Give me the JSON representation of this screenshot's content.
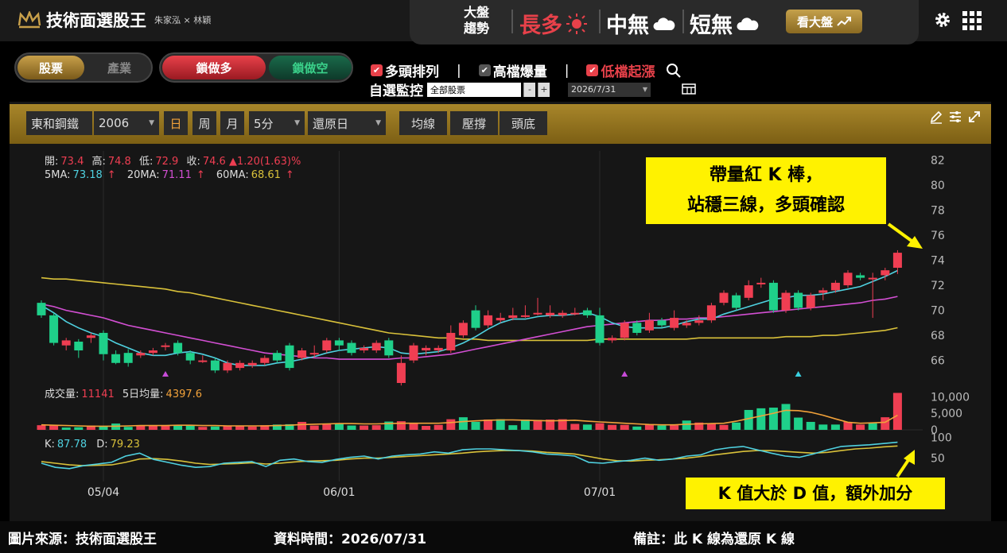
{
  "app": {
    "name": "技術面選股王",
    "authors": "朱家泓 × 林穎"
  },
  "market_trend": {
    "label_line1": "大盤",
    "label_line2": "趨勢",
    "long": "長多",
    "mid": "中無",
    "short": "短無",
    "market_button": "看大盤"
  },
  "toolbar": {
    "tab_stock": "股票",
    "tab_industry": "產業",
    "lock_long": "鎖做多",
    "lock_short": "鎖做空",
    "filter_bull": "多頭排列",
    "filter_volume": "高檔爆量",
    "filter_low": "低檔起漲",
    "separator": "|",
    "watch_label": "自選監控",
    "watch_select": "全部股票",
    "watch_minus": "-",
    "watch_plus": "+",
    "date_select": "2026/7/31"
  },
  "chart_toolbar": {
    "stock_name": "東和鋼鐵",
    "stock_code": "2006",
    "period_day": "日",
    "period_week": "周",
    "period_month": "月",
    "interval": "5分",
    "adjust": "還原日",
    "btn_ma": "均線",
    "btn_pressure": "壓撐",
    "btn_bottom": "頭底"
  },
  "quote": {
    "open_label": "開:",
    "open": "73.4",
    "high_label": "高:",
    "high": "74.8",
    "low_label": "低:",
    "low": "72.9",
    "close_label": "收:",
    "close": "74.6",
    "change": "▲1.20(1.63)%",
    "ma5_label": "5MA:",
    "ma5": "73.18",
    "ma20_label": "20MA:",
    "ma20": "71.11",
    "ma60_label": "60MA:",
    "ma60": "68.61",
    "up_arrow": "↑",
    "vol_label": "成交量:",
    "vol": "11141",
    "vol5_label": "5日均量:",
    "vol5": "4397.6",
    "k_label": "K:",
    "k": "87.78",
    "d_label": "D:",
    "d": "79.23"
  },
  "footer": {
    "source": "圖片來源：技術面選股王",
    "data_time": "資料時間：2026/07/31",
    "note": "備註：此 K 線為還原 K 線"
  },
  "callouts": {
    "c1_line1": "帶量紅 K 棒，",
    "c1_line2": "站穩三線，多頭確認",
    "c2": "K 值大於 D 值，額外加分"
  },
  "colors": {
    "up": "#ef3e52",
    "down": "#1fd08a",
    "ma5": "#4fd1e0",
    "ma20": "#d34fd3",
    "ma60": "#d9c13a",
    "accent": "#c8a04a",
    "callout": "#fff200"
  },
  "chart_data": {
    "type": "candlestick",
    "price_axis": {
      "ticks": [
        66,
        68,
        70,
        72,
        74,
        76,
        78,
        80,
        82
      ],
      "ylim": [
        64.2,
        82.6
      ]
    },
    "volume_axis": {
      "ticks": [
        0,
        5000,
        10000
      ],
      "tick_labels": [
        "0",
        "5,000",
        "10,000"
      ]
    },
    "kd_axis": {
      "ticks": [
        50,
        100
      ],
      "ylim": [
        0,
        110
      ]
    },
    "x_labels": [
      {
        "label": "05/04",
        "index": 5
      },
      {
        "label": "06/01",
        "index": 24
      },
      {
        "label": "07/01",
        "index": 45
      }
    ],
    "candles": [
      [
        70.6,
        69.6,
        70.8,
        69.4
      ],
      [
        69.6,
        67.4,
        69.8,
        67.2
      ],
      [
        67.2,
        67.6,
        67.8,
        66.8
      ],
      [
        67.5,
        66.8,
        67.7,
        66.2
      ],
      [
        67.8,
        68.0,
        68.2,
        67.4
      ],
      [
        68.2,
        66.5,
        68.4,
        66.0
      ],
      [
        66.5,
        65.8,
        66.8,
        65.7
      ],
      [
        66.6,
        65.8,
        66.9,
        65.5
      ],
      [
        66.4,
        66.6,
        66.8,
        66.2
      ],
      [
        66.6,
        66.8,
        67.0,
        66.4
      ],
      [
        67.2,
        67.2,
        67.4,
        66.8
      ],
      [
        67.4,
        66.6,
        67.6,
        66.4
      ],
      [
        66.6,
        66.0,
        66.8,
        65.7
      ],
      [
        66.0,
        66.0,
        66.4,
        65.8
      ],
      [
        66.0,
        65.2,
        66.2,
        65.0
      ],
      [
        65.2,
        65.8,
        66.0,
        65.0
      ],
      [
        65.4,
        65.8,
        66.0,
        65.2
      ],
      [
        65.6,
        65.8,
        66.0,
        65.4
      ],
      [
        65.8,
        66.2,
        66.4,
        65.6
      ],
      [
        66.6,
        66.0,
        66.8,
        65.8
      ],
      [
        67.2,
        65.4,
        67.4,
        65.2
      ],
      [
        66.2,
        66.8,
        67.0,
        66.0
      ],
      [
        66.6,
        66.6,
        67.2,
        66.2
      ],
      [
        66.8,
        67.6,
        67.8,
        66.6
      ],
      [
        67.6,
        67.2,
        67.8,
        66.8
      ],
      [
        67.4,
        66.6,
        67.6,
        66.4
      ],
      [
        66.8,
        67.0,
        67.2,
        66.6
      ],
      [
        66.8,
        67.4,
        67.6,
        66.6
      ],
      [
        67.6,
        66.4,
        67.8,
        66.2
      ],
      [
        64.2,
        65.8,
        66.4,
        64.0
      ],
      [
        66.0,
        67.2,
        67.4,
        65.8
      ],
      [
        66.8,
        67.0,
        67.2,
        66.4
      ],
      [
        66.8,
        67.0,
        67.2,
        66.6
      ],
      [
        66.8,
        68.2,
        68.8,
        66.6
      ],
      [
        68.0,
        69.0,
        69.2,
        67.8
      ],
      [
        70.0,
        68.6,
        70.4,
        68.4
      ],
      [
        68.8,
        69.6,
        70.0,
        68.6
      ],
      [
        69.2,
        69.4,
        69.8,
        69.0
      ],
      [
        69.4,
        69.6,
        70.2,
        69.2
      ],
      [
        69.6,
        69.6,
        70.4,
        69.4
      ],
      [
        69.8,
        69.8,
        71.0,
        69.6
      ],
      [
        69.6,
        69.8,
        70.4,
        69.4
      ],
      [
        69.6,
        69.8,
        70.0,
        69.4
      ],
      [
        69.8,
        69.8,
        70.2,
        69.6
      ],
      [
        70.0,
        69.6,
        70.2,
        69.4
      ],
      [
        69.6,
        67.4,
        70.2,
        67.2
      ],
      [
        67.6,
        67.8,
        68.0,
        67.4
      ],
      [
        67.8,
        69.0,
        69.2,
        67.6
      ],
      [
        69.0,
        68.2,
        69.2,
        68.0
      ],
      [
        68.4,
        69.2,
        69.8,
        68.2
      ],
      [
        69.2,
        68.8,
        69.4,
        68.6
      ],
      [
        68.6,
        69.4,
        70.0,
        68.4
      ],
      [
        68.8,
        69.0,
        69.2,
        68.6
      ],
      [
        69.0,
        69.2,
        69.6,
        68.8
      ],
      [
        69.2,
        70.4,
        70.6,
        69.0
      ],
      [
        70.6,
        71.4,
        71.6,
        70.4
      ],
      [
        71.2,
        70.2,
        71.4,
        70.0
      ],
      [
        71.0,
        72.0,
        72.4,
        70.8
      ],
      [
        72.2,
        72.2,
        72.6,
        71.8
      ],
      [
        72.2,
        70.0,
        72.4,
        69.8
      ],
      [
        70.0,
        71.4,
        71.6,
        69.8
      ],
      [
        71.4,
        70.2,
        71.6,
        70.0
      ],
      [
        70.2,
        71.2,
        71.4,
        70.0
      ],
      [
        71.4,
        71.6,
        71.8,
        70.8
      ],
      [
        71.6,
        72.2,
        72.4,
        71.4
      ],
      [
        72.0,
        73.0,
        73.2,
        71.8
      ],
      [
        72.8,
        72.6,
        73.0,
        72.4
      ],
      [
        72.6,
        72.6,
        73.0,
        69.4
      ],
      [
        72.8,
        73.2,
        73.4,
        72.4
      ],
      [
        73.4,
        74.6,
        74.8,
        72.9
      ]
    ],
    "volumes": [
      1400,
      1300,
      700,
      800,
      1300,
      1000,
      1900,
      900,
      1200,
      1400,
      1400,
      1500,
      1300,
      900,
      1000,
      1200,
      1300,
      1000,
      1400,
      1600,
      1700,
      2400,
      1300,
      1900,
      1900,
      1300,
      1300,
      1400,
      2500,
      2600,
      2100,
      1200,
      1500,
      3200,
      3800,
      2400,
      3100,
      3200,
      1400,
      3100,
      3000,
      3100,
      3200,
      1800,
      1600,
      2000,
      1500,
      1500,
      1000,
      1700,
      1300,
      1400,
      2800,
      2200,
      1900,
      1500,
      2200,
      6000,
      6500,
      6700,
      7800,
      3700,
      2400,
      1600,
      1600,
      2400,
      1600,
      2000,
      3800,
      11141
    ],
    "vol_bar_colors": [
      "up",
      "up",
      "down",
      "down",
      "up",
      "down",
      "down",
      "down",
      "up",
      "up",
      "up",
      "down",
      "down",
      "up",
      "down",
      "up",
      "up",
      "up",
      "up",
      "down",
      "down",
      "up",
      "up",
      "up",
      "down",
      "down",
      "up",
      "up",
      "down",
      "up",
      "up",
      "up",
      "up",
      "up",
      "down",
      "down",
      "up",
      "down",
      "down",
      "down",
      "up",
      "up",
      "up",
      "up",
      "down",
      "up",
      "up",
      "up",
      "down",
      "up",
      "down",
      "up",
      "down",
      "up",
      "up",
      "up",
      "down",
      "down",
      "down",
      "down",
      "down",
      "down",
      "down",
      "down",
      "down",
      "up",
      "up",
      "down",
      "up",
      "up"
    ],
    "ma5": [
      70.4,
      69.8,
      69.1,
      68.6,
      68.2,
      67.9,
      67.4,
      67.0,
      66.6,
      66.4,
      66.4,
      66.6,
      66.7,
      66.5,
      66.2,
      65.8,
      65.6,
      65.6,
      65.6,
      65.8,
      65.9,
      66.1,
      66.3,
      66.6,
      66.8,
      66.9,
      67.0,
      67.1,
      67.0,
      66.6,
      66.5,
      66.6,
      66.7,
      67.0,
      67.4,
      67.9,
      68.5,
      69.0,
      69.3,
      69.3,
      69.5,
      69.6,
      69.6,
      69.7,
      69.8,
      69.5,
      69.0,
      68.7,
      68.6,
      68.6,
      68.6,
      68.8,
      69.1,
      69.3,
      69.3,
      69.7,
      70.0,
      70.3,
      70.6,
      70.9,
      71.0,
      71.2,
      71.2,
      71.3,
      71.5,
      71.7,
      71.9,
      72.3,
      72.7,
      73.18
    ],
    "ma20": [
      70.5,
      70.3,
      70.0,
      69.8,
      69.6,
      69.4,
      69.1,
      68.8,
      68.6,
      68.4,
      68.2,
      68.0,
      67.8,
      67.6,
      67.4,
      67.2,
      67.0,
      66.8,
      66.6,
      66.5,
      66.4,
      66.3,
      66.2,
      66.2,
      66.1,
      66.1,
      66.1,
      66.1,
      66.1,
      66.2,
      66.2,
      66.3,
      66.4,
      66.5,
      66.7,
      66.9,
      67.1,
      67.3,
      67.5,
      67.7,
      67.9,
      68.1,
      68.3,
      68.5,
      68.7,
      68.8,
      68.9,
      69.0,
      69.1,
      69.2,
      69.2,
      69.3,
      69.3,
      69.4,
      69.4,
      69.5,
      69.6,
      69.7,
      69.8,
      69.9,
      70.0,
      70.1,
      70.2,
      70.3,
      70.4,
      70.5,
      70.6,
      70.8,
      70.9,
      71.11
    ],
    "ma60": [
      72.6,
      72.5,
      72.5,
      72.4,
      72.3,
      72.2,
      72.1,
      72.0,
      71.9,
      71.8,
      71.7,
      71.5,
      71.4,
      71.2,
      71.0,
      70.8,
      70.6,
      70.4,
      70.2,
      70.0,
      69.8,
      69.6,
      69.4,
      69.2,
      69.0,
      68.8,
      68.6,
      68.4,
      68.2,
      68.1,
      68.0,
      67.9,
      67.8,
      67.8,
      67.7,
      67.7,
      67.6,
      67.6,
      67.6,
      67.6,
      67.6,
      67.6,
      67.6,
      67.6,
      67.6,
      67.7,
      67.7,
      67.7,
      67.7,
      67.7,
      67.7,
      67.7,
      67.7,
      67.8,
      67.8,
      67.8,
      67.8,
      67.8,
      67.8,
      67.8,
      67.9,
      67.9,
      67.9,
      68.0,
      68.0,
      68.1,
      68.2,
      68.3,
      68.4,
      68.61
    ],
    "vol_ma": [
      1500,
      1400,
      1300,
      1200,
      1100,
      1100,
      1100,
      1200,
      1300,
      1300,
      1300,
      1400,
      1400,
      1300,
      1300,
      1200,
      1200,
      1200,
      1200,
      1300,
      1400,
      1600,
      1700,
      1800,
      1900,
      1900,
      1800,
      1800,
      1900,
      2000,
      2000,
      2000,
      2000,
      2200,
      2500,
      2700,
      2900,
      3000,
      3000,
      2900,
      2800,
      2700,
      2800,
      2900,
      2600,
      2400,
      2200,
      2000,
      1800,
      1600,
      1500,
      1500,
      1700,
      1800,
      1900,
      2000,
      2600,
      3400,
      4200,
      5000,
      5900,
      5800,
      5300,
      4400,
      3300,
      2300,
      2000,
      2100,
      2300,
      4397.6
    ],
    "k_values": [
      38,
      28,
      25,
      32,
      36,
      40,
      55,
      62,
      47,
      40,
      33,
      28,
      30,
      38,
      40,
      42,
      30,
      45,
      48,
      42,
      40,
      47,
      52,
      55,
      48,
      55,
      58,
      60,
      65,
      62,
      70,
      72,
      72,
      70,
      68,
      65,
      60,
      58,
      55,
      40,
      38,
      42,
      45,
      50,
      45,
      48,
      55,
      58,
      70,
      75,
      78,
      70,
      62,
      55,
      52,
      60,
      70,
      78,
      80,
      82,
      85,
      88
    ],
    "d_values": [
      42,
      38,
      34,
      32,
      33,
      34,
      40,
      48,
      49,
      47,
      43,
      38,
      35,
      36,
      37,
      39,
      36,
      38,
      41,
      43,
      44,
      45,
      48,
      50,
      50,
      52,
      54,
      56,
      58,
      60,
      62,
      65,
      67,
      68,
      68,
      67,
      64,
      62,
      60,
      54,
      48,
      44,
      43,
      45,
      46,
      48,
      50,
      54,
      58,
      62,
      66,
      68,
      68,
      66,
      64,
      62,
      64,
      68,
      72,
      74,
      77,
      79
    ],
    "markers": [
      {
        "index": 10,
        "color": "#c74bd8"
      },
      {
        "index": 47,
        "color": "#c74bd8"
      },
      {
        "index": 61,
        "color": "#3ad0e0"
      }
    ]
  }
}
